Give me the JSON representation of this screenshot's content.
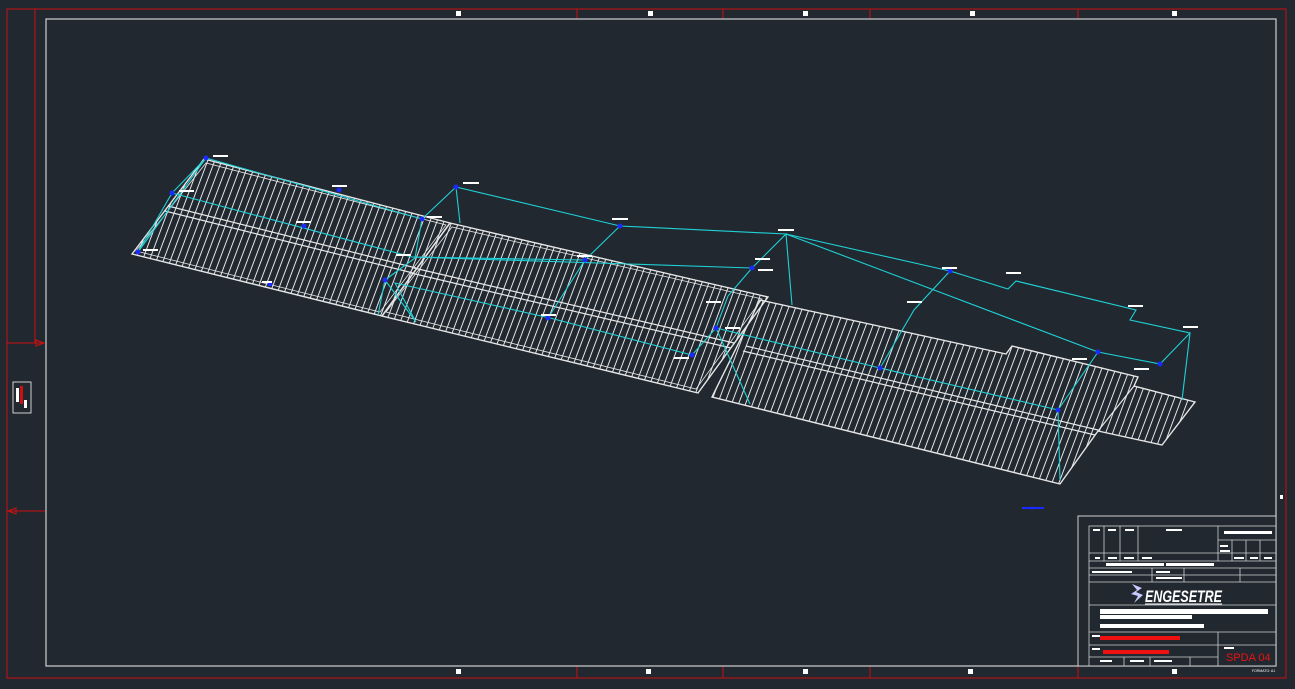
{
  "title_block": {
    "company": "ENGESETRE",
    "sheet_id": "SPDA 04",
    "format_label": "FORMATO: A1"
  },
  "colors": {
    "background": "#212830",
    "frame_red": "#cc1111",
    "sheet_border": "#d0d0d0",
    "roof_lines": "#e6e6e6",
    "conductor": "#1fd1d6",
    "node": "#1a2bff",
    "label_bars": "#ffffff"
  },
  "icons": {
    "logo": "engesetre-logo-icon",
    "orientation_marker": "orientation-marker-icon"
  }
}
